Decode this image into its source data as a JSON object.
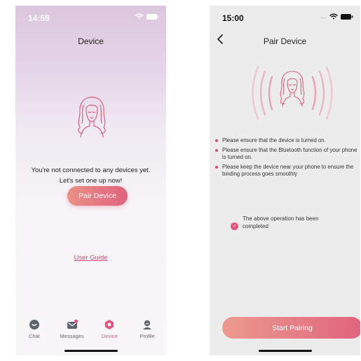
{
  "colors": {
    "accent": "#e0567a",
    "pair_button_gradient": [
      "#ea8f86",
      "#e0647d"
    ],
    "start_button_gradient": [
      "#ec9a8e",
      "#e0647d"
    ],
    "link": "#c94d6e",
    "bullet": "#d94b72"
  },
  "device_screen": {
    "status_time": "14:59",
    "title": "Device",
    "empty_line1": "You're not connected to any devices yet.",
    "empty_line2": "Let's set one up now!",
    "pair_button": "Pair Device",
    "user_guide": "User Guide",
    "tabs": [
      {
        "label": "Chat",
        "icon": "chat-icon"
      },
      {
        "label": "Messages",
        "icon": "mail-icon"
      },
      {
        "label": "Device",
        "icon": "device-icon",
        "active": true
      },
      {
        "label": "Profile",
        "icon": "profile-icon"
      }
    ]
  },
  "pair_screen": {
    "status_time": "15:00",
    "status_dots": "....",
    "title": "Pair Device",
    "instructions": [
      "Please ensure that the device is turned on.",
      "Please ensure that the Bluetooth function of your phone is turned on.",
      "Please keep the device near your phone to ensure the binding process goes smoothly"
    ],
    "confirm_text": "The above operation has been completed",
    "start_button": "Start Pairing"
  }
}
